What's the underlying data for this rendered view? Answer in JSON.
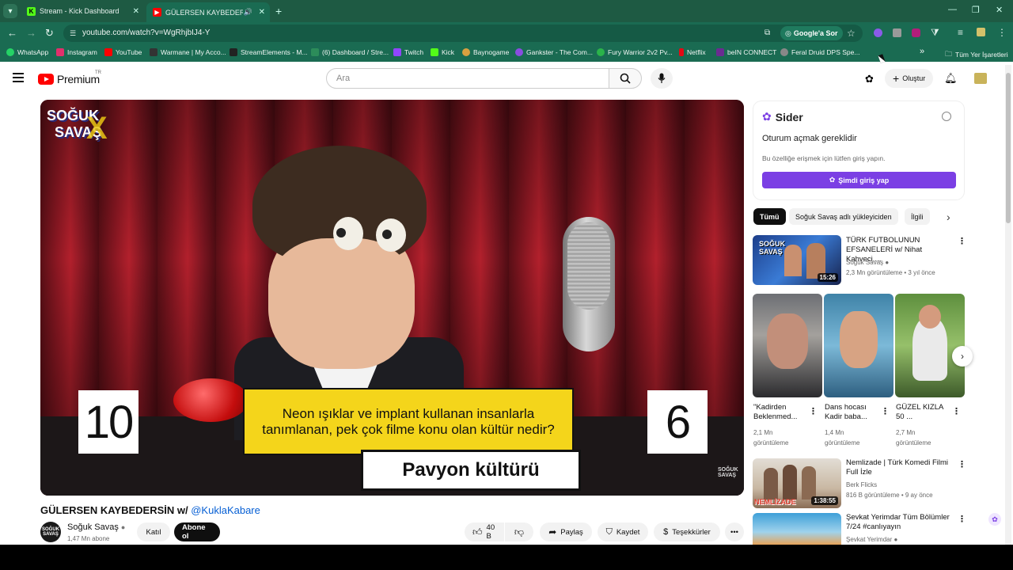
{
  "browser": {
    "tabs": [
      {
        "title": "Stream - Kick Dashboard",
        "favicon": "kick-icon"
      },
      {
        "title": "GÜLERSEN KAYBEDERSİN w/",
        "favicon": "youtube-icon"
      }
    ],
    "url": "youtube.com/watch?v=WgRhjbIJ4-Y",
    "google_lens_label": "Google'a Sor",
    "bookmarks": [
      {
        "label": "WhatsApp",
        "color": "#25d366"
      },
      {
        "label": "Instagram",
        "color": "#e1306c"
      },
      {
        "label": "YouTube",
        "color": "#ff0000"
      },
      {
        "label": "Warmane | My Acco...",
        "color": "#333333"
      },
      {
        "label": "StreamElements - M...",
        "color": "#222222"
      },
      {
        "label": "(6) Dashboard / Stre...",
        "color": "#2c8c5a"
      },
      {
        "label": "Twitch",
        "color": "#9146ff"
      },
      {
        "label": "Kick",
        "color": "#53fc18"
      },
      {
        "label": "Baynogame",
        "color": "#d8a040"
      },
      {
        "label": "Gankster - The Com...",
        "color": "#8a4de0"
      },
      {
        "label": "Fury Warrior 2v2 Pv...",
        "color": "#2bb34a"
      },
      {
        "label": "Netflix",
        "color": "#e50914"
      },
      {
        "label": "beIN CONNECT",
        "color": "#6a2c91"
      },
      {
        "label": "Feral Druid DPS Spe...",
        "color": "#888888"
      }
    ],
    "all_bookmarks_label": "Tüm Yer İşaretleri",
    "more_bookmarks": "»"
  },
  "youtube": {
    "brand": "Premium",
    "region": "TR",
    "search_placeholder": "Ara",
    "create_label": "Oluştur"
  },
  "video": {
    "overlay_logo_line1": "SOĞUK",
    "overlay_logo_line2": "SAVAŞ",
    "score_left": "10",
    "score_right": "6",
    "question": "Neon ışıklar ve implant kullanan insanlarla tanımlanan, pek çok filme konu olan kültür nedir?",
    "answer": "Pavyon kültürü",
    "watermark_line1": "SOĞUK",
    "watermark_line2": "SAVAŞ",
    "title_prefix": "GÜLERSEN KAYBEDERSİN w/",
    "title_mention": "@KuklaKabare",
    "channel_name": "Soğuk Savaş",
    "avatar_line1": "SOĞUK",
    "avatar_line2": "SAVAŞ",
    "subscribers": "1,47 Mn abone",
    "join_label": "Katıl",
    "subscribe_label": "Abone ol",
    "likes": "40 B",
    "share_label": "Paylaş",
    "save_label": "Kaydet",
    "thanks_label": "Teşekkürler"
  },
  "sider": {
    "brand": "Sider",
    "heading": "Oturum açmak gereklidir",
    "text": "Bu özelliğe erişmek için lütfen giriş yapın.",
    "button": "Şimdi giriş yap"
  },
  "chips": [
    "Tümü",
    "Soğuk Savaş adlı yükleyiciden",
    "İlgili"
  ],
  "recommendations": [
    {
      "title": "TÜRK FUTBOLUNUN EFSANELERİ w/ Nihat Kahveci,...",
      "channel": "Soğuk Savaş",
      "meta": "2,3 Mn görüntüleme • 3 yıl önce",
      "duration": "15:26"
    },
    {
      "title": "Nemlizade | Türk Komedi Filmi Full İzle",
      "channel": "Berk Flicks",
      "meta": "816 B görüntüleme • 9 ay önce",
      "duration": "1:38:55",
      "thumb_text": "NEMLİZADE"
    },
    {
      "title": "Şevkat Yerimdar Tüm Bölümler 7/24 #canlıyayın",
      "channel": "Şevkat Yerimdar",
      "meta": ""
    }
  ],
  "shorts": [
    {
      "title": "\"Kadirden Beklenmed...",
      "views": "2,1 Mn",
      "views_label": "görüntüleme"
    },
    {
      "title": "Dans hocası Kadir baba...",
      "views": "1,4 Mn",
      "views_label": "görüntüleme"
    },
    {
      "title": "GÜZEL KIZLA 50 ...",
      "views": "2,7 Mn",
      "views_label": "görüntüleme"
    }
  ],
  "colors": {
    "chrome_green": "#1a6b52",
    "youtube_red": "#ff0000",
    "sider_purple": "#7b3fe4",
    "link_blue": "#065fd4"
  }
}
